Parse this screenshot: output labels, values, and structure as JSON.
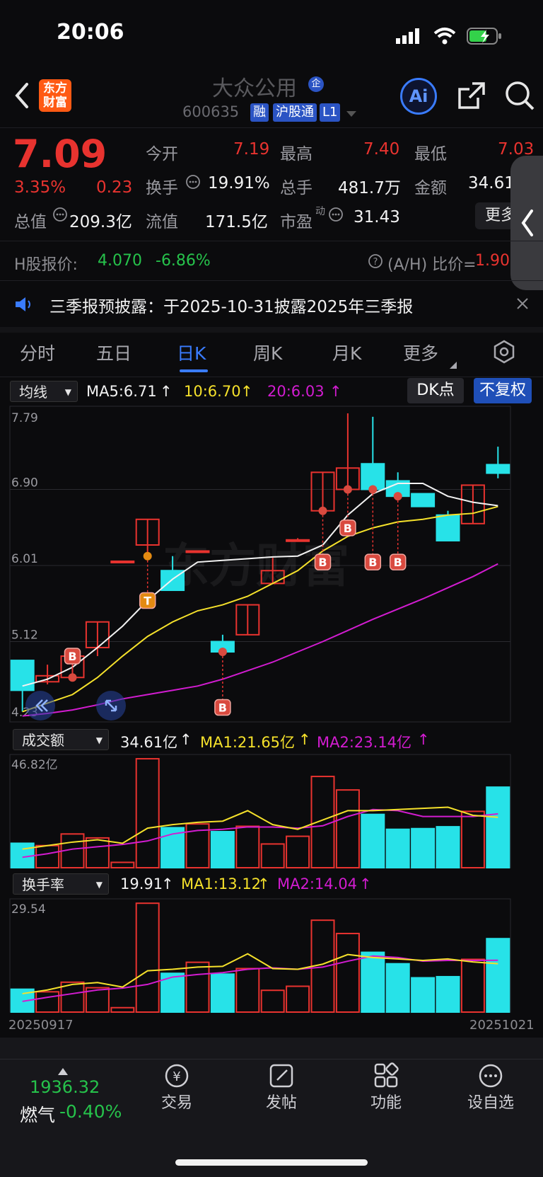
{
  "status": {
    "time": "20:06"
  },
  "header": {
    "logo_text": "东方财富",
    "title": "大众公用",
    "title_badge": "企",
    "code": "600635",
    "tags": [
      "融",
      "沪股通",
      "L1"
    ],
    "ai_label": "Ai"
  },
  "quote": {
    "price": "7.09",
    "change_pct": "3.35%",
    "change_amt": "0.23",
    "rows": [
      [
        {
          "label": "今开",
          "value": "7.19"
        },
        {
          "label": "最高",
          "value": "7.40"
        },
        {
          "label": "最低",
          "value": "7.03"
        }
      ],
      [
        {
          "label": "换手",
          "value": "19.91%"
        },
        {
          "label": "总手",
          "value": "481.7万"
        },
        {
          "label": "金额",
          "value": "34.61"
        }
      ],
      [
        {
          "label": "总值",
          "value": "209.3亿"
        },
        {
          "label": "流值",
          "value": "171.5亿"
        },
        {
          "label": "市盈",
          "value": "31.43"
        }
      ]
    ],
    "pe_sup": "动",
    "more_label": "更多"
  },
  "hshare": {
    "label": "H股报价:",
    "price": "4.070",
    "change": "-6.86%",
    "ratio_label": "(A/H) 比价=",
    "ratio": "1.90"
  },
  "notice": {
    "text": "三季报预披露：于2025-10-31披露2025年三季报"
  },
  "tabs": [
    "分时",
    "五日",
    "日K",
    "周K",
    "月K",
    "更多"
  ],
  "active_tab": 2,
  "ma_bar": {
    "selector": "均线",
    "ma5": "MA5:6.71",
    "ma10": "10:6.70",
    "ma20": "20:6.03",
    "dk": "DK点",
    "fq": "不复权"
  },
  "vol_bar": {
    "selector": "成交额",
    "value": "34.61亿",
    "ma1": "MA1:21.65亿",
    "ma2": "MA2:23.14亿"
  },
  "turn_bar": {
    "selector": "换手率",
    "value": "19.91",
    "ma1": "MA1:13.12",
    "ma2": "MA2:14.04"
  },
  "chart_data": [
    {
      "type": "candlestick",
      "y_labels": [
        "7.79",
        "6.90",
        "6.01",
        "5.12",
        "4.23"
      ],
      "ylim": [
        4.23,
        7.79
      ],
      "watermark": "东方财富",
      "candles": [
        {
          "o": 4.9,
          "c": 4.55,
          "h": 4.9,
          "l": 4.3
        },
        {
          "o": 4.65,
          "c": 4.72,
          "h": 4.85,
          "l": 4.62
        },
        {
          "o": 4.7,
          "c": 4.95,
          "h": 4.95,
          "l": 4.7
        },
        {
          "o": 5.05,
          "c": 5.35,
          "h": 5.35,
          "l": 4.95
        },
        {
          "o": 6.05,
          "c": 6.06,
          "h": 6.05,
          "l": 6.06
        },
        {
          "o": 6.25,
          "c": 6.55,
          "h": 6.55,
          "l": 6.12
        },
        {
          "o": 5.95,
          "c": 5.72,
          "h": 6.12,
          "l": 5.72
        },
        {
          "o": 6.18,
          "c": 6.18,
          "h": 6.18,
          "l": 6.18
        },
        {
          "o": 5.12,
          "c": 5.0,
          "h": 5.2,
          "l": 5.0
        },
        {
          "o": 5.2,
          "c": 5.55,
          "h": 5.55,
          "l": 5.2
        },
        {
          "o": 5.8,
          "c": 5.95,
          "h": 6.1,
          "l": 5.8
        },
        {
          "o": 6.3,
          "c": 6.31,
          "h": 6.33,
          "l": 6.3
        },
        {
          "o": 6.65,
          "c": 7.1,
          "h": 7.1,
          "l": 6.65
        },
        {
          "o": 6.9,
          "c": 7.15,
          "h": 7.79,
          "l": 6.9
        },
        {
          "o": 7.2,
          "c": 6.9,
          "h": 7.75,
          "l": 6.9
        },
        {
          "o": 7.0,
          "c": 6.82,
          "h": 7.1,
          "l": 6.82
        },
        {
          "o": 6.85,
          "c": 6.7,
          "h": 6.85,
          "l": 6.7
        },
        {
          "o": 6.6,
          "c": 6.3,
          "h": 6.65,
          "l": 6.3
        },
        {
          "o": 6.5,
          "c": 6.95,
          "h": 6.95,
          "l": 6.5
        },
        {
          "o": 7.19,
          "c": 7.09,
          "h": 7.4,
          "l": 7.03
        }
      ],
      "ma5": [
        4.6,
        4.68,
        4.82,
        5.05,
        5.3,
        5.6,
        5.85,
        6.05,
        6.07,
        6.09,
        6.11,
        6.12,
        6.25,
        6.6,
        6.85,
        6.97,
        6.97,
        6.82,
        6.75,
        6.71
      ],
      "ma10": [
        4.3,
        4.4,
        4.5,
        4.7,
        4.95,
        5.18,
        5.35,
        5.48,
        5.55,
        5.65,
        5.8,
        5.95,
        6.18,
        6.35,
        6.45,
        6.52,
        6.55,
        6.6,
        6.62,
        6.7
      ],
      "ma20": [
        4.25,
        4.28,
        4.32,
        4.38,
        4.45,
        4.5,
        4.55,
        4.6,
        4.68,
        4.78,
        4.88,
        5.0,
        5.12,
        5.25,
        5.38,
        5.5,
        5.62,
        5.75,
        5.88,
        6.03
      ],
      "markers": [
        {
          "i": 2,
          "type": "B",
          "y": 4.95
        },
        {
          "i": 5,
          "type": "T",
          "y": 5.6
        },
        {
          "i": 8,
          "type": "B",
          "y": 4.35
        },
        {
          "i": 12,
          "type": "B",
          "y": 6.05
        },
        {
          "i": 13,
          "type": "B",
          "y": 6.45
        },
        {
          "i": 14,
          "type": "B",
          "y": 6.05
        },
        {
          "i": 15,
          "type": "B",
          "y": 6.05
        }
      ]
    },
    {
      "type": "bar",
      "unit": "亿",
      "y_label": "46.82亿",
      "ylim": [
        0,
        46.82
      ],
      "values": [
        10.5,
        9.5,
        14.5,
        12.8,
        2.3,
        46.8,
        17.2,
        18.8,
        15.5,
        17.8,
        10.2,
        13.5,
        39.2,
        33.4,
        22.9,
        16.5,
        16.8,
        17.6,
        24.2,
        34.61
      ],
      "ma1": [
        8,
        9.5,
        11,
        12,
        10.5,
        17,
        18.5,
        19.5,
        20,
        24.5,
        18.5,
        16.5,
        20.5,
        24.5,
        24.5,
        25,
        25.5,
        26,
        22.5,
        21.65
      ],
      "ma2": [
        4.5,
        6,
        8,
        9,
        10,
        11.5,
        14.5,
        16,
        16.5,
        17.5,
        17.5,
        17,
        18,
        22,
        25,
        24.5,
        22,
        22,
        22,
        23.14
      ]
    },
    {
      "type": "bar",
      "y_label": "29.54",
      "ylim": [
        0,
        29.54
      ],
      "values": [
        6.2,
        5.5,
        8.1,
        6.6,
        1.2,
        29.5,
        10.5,
        13.5,
        10.3,
        11.8,
        5.9,
        7.0,
        24.9,
        21.3,
        16.2,
        13.1,
        9.3,
        9.6,
        14.3,
        19.91
      ],
      "ma1": [
        5,
        6,
        7.5,
        8,
        6.8,
        11.2,
        11.6,
        12.2,
        12.4,
        15.8,
        11.8,
        11.6,
        13.0,
        15.6,
        14.8,
        14.4,
        14.0,
        14.4,
        13.6,
        13.12
      ],
      "ma2": [
        2.9,
        4,
        5,
        6,
        6.5,
        7.5,
        9.5,
        10.2,
        10.7,
        11.6,
        12,
        11.6,
        12.2,
        13.8,
        15.2,
        14.8,
        13.8,
        14.0,
        14.0,
        14.04
      ]
    }
  ],
  "x_labels": {
    "start": "20250917",
    "end": "20251021"
  },
  "bottom_ticker": {
    "value": "1936.32",
    "name": "燃气",
    "change": "-0.40%"
  },
  "nav": [
    "交易",
    "发帖",
    "功能",
    "设自选"
  ],
  "colors": {
    "up": "#e8332f",
    "down": "#27e2e8",
    "ma5": "#f2f2f2",
    "ma10": "#f5e12b",
    "ma20": "#d21cd0",
    "accent": "#3a7cff"
  }
}
